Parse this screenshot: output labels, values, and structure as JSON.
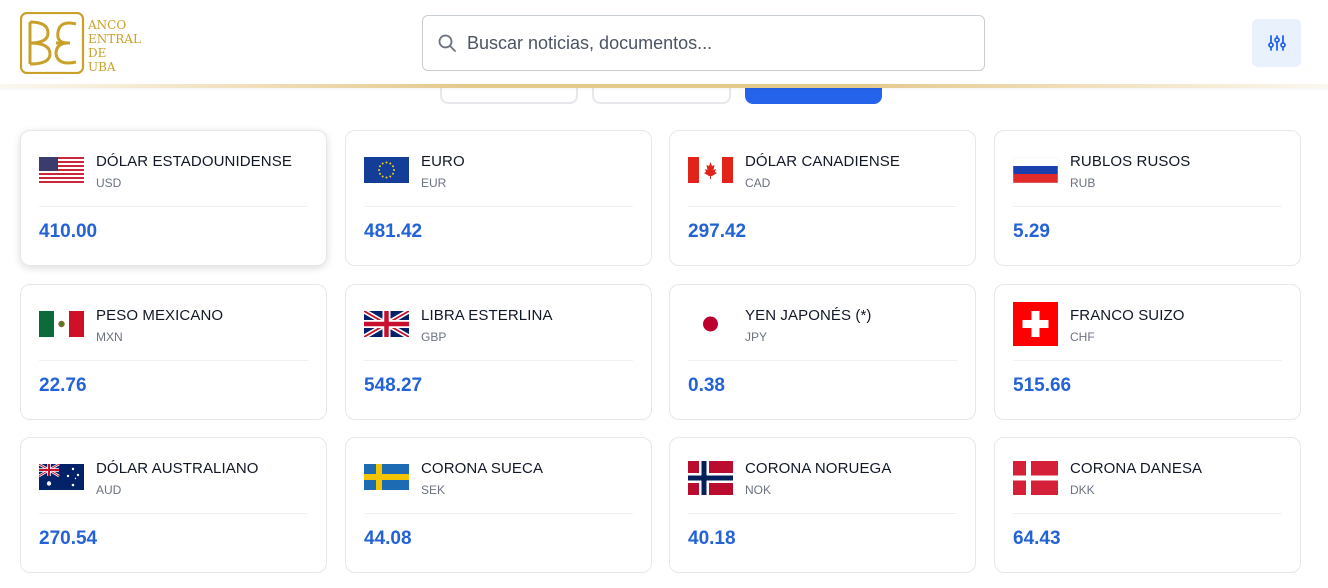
{
  "header": {
    "logo_text": [
      "ANCO",
      "ENTRAL DE",
      "UBA"
    ],
    "search_placeholder": "Buscar noticias, documentos...",
    "filter_icon": "sliders-icon",
    "search_icon": "search-icon"
  },
  "colors": {
    "accent": "#2563eb",
    "value": "#2463d6",
    "gold": "#c9a02a"
  },
  "currencies": [
    {
      "name": "DÓLAR ESTADOUNIDENSE",
      "code": "USD",
      "value": "410.00",
      "flag": "us-flag-icon"
    },
    {
      "name": "EURO",
      "code": "EUR",
      "value": "481.42",
      "flag": "eu-flag-icon"
    },
    {
      "name": "DÓLAR CANADIENSE",
      "code": "CAD",
      "value": "297.42",
      "flag": "canada-flag-icon"
    },
    {
      "name": "RUBLOS RUSOS",
      "code": "RUB",
      "value": "5.29",
      "flag": "russia-flag-icon"
    },
    {
      "name": "PESO MEXICANO",
      "code": "MXN",
      "value": "22.76",
      "flag": "mexico-flag-icon"
    },
    {
      "name": "LIBRA ESTERLINA",
      "code": "GBP",
      "value": "548.27",
      "flag": "uk-flag-icon"
    },
    {
      "name": "YEN JAPONÉS (*)",
      "code": "JPY",
      "value": "0.38",
      "flag": "japan-flag-icon"
    },
    {
      "name": "FRANCO SUIZO",
      "code": "CHF",
      "value": "515.66",
      "flag": "switzerland-flag-icon"
    },
    {
      "name": "DÓLAR AUSTRALIANO",
      "code": "AUD",
      "value": "270.54",
      "flag": "australia-flag-icon"
    },
    {
      "name": "CORONA SUECA",
      "code": "SEK",
      "value": "44.08",
      "flag": "sweden-flag-icon"
    },
    {
      "name": "CORONA NORUEGA",
      "code": "NOK",
      "value": "40.18",
      "flag": "norway-flag-icon"
    },
    {
      "name": "CORONA DANESA",
      "code": "DKK",
      "value": "64.43",
      "flag": "denmark-flag-icon"
    }
  ]
}
